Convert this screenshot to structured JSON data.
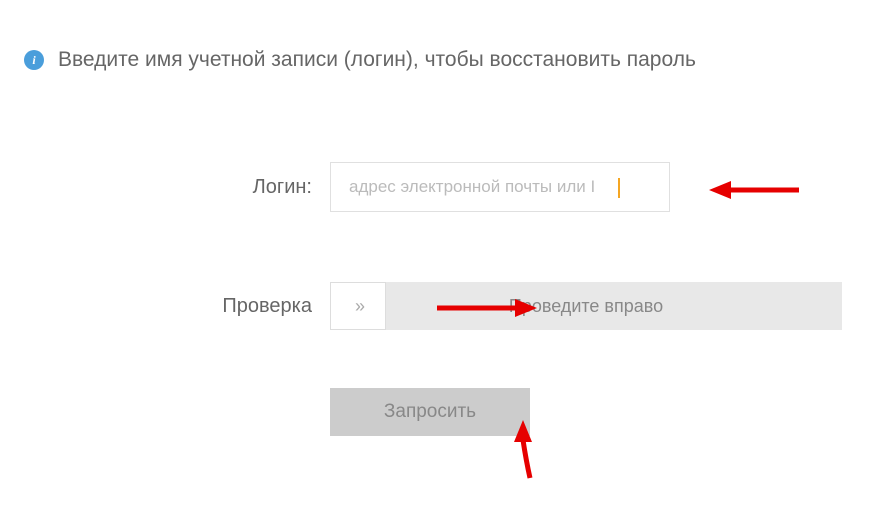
{
  "header": {
    "instruction": "Введите имя учетной записи (логин), чтобы восстановить пароль",
    "info_icon_label": "i"
  },
  "form": {
    "login": {
      "label": "Логин:",
      "placeholder": "адрес электронной почты или I"
    },
    "verification": {
      "label": "Проверка",
      "slider_text": "Проведите вправо",
      "slider_arrows": "»"
    },
    "submit": {
      "label": "Запросить"
    }
  }
}
